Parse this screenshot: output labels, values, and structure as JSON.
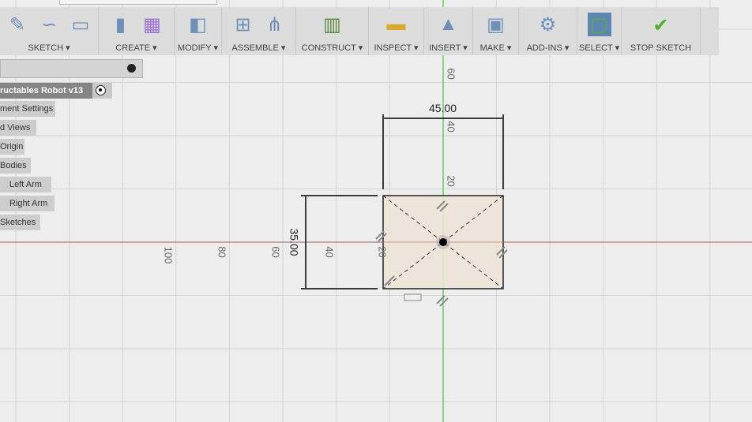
{
  "toolbar": {
    "groups": [
      {
        "label": "SKETCH ▾",
        "icons": [
          "create-sketch-icon",
          "spline-icon",
          "rectangle-icon"
        ]
      },
      {
        "label": "CREATE ▾",
        "icons": [
          "extrude-icon",
          "form-icon"
        ]
      },
      {
        "label": "MODIFY ▾",
        "icons": [
          "press-pull-icon"
        ]
      },
      {
        "label": "ASSEMBLE ▾",
        "icons": [
          "new-component-icon",
          "joint-icon"
        ]
      },
      {
        "label": "CONSTRUCT ▾",
        "icons": [
          "offset-plane-icon"
        ]
      },
      {
        "label": "INSPECT ▾",
        "icons": [
          "measure-icon"
        ]
      },
      {
        "label": "INSERT ▾",
        "icons": [
          "insert-image-icon"
        ]
      },
      {
        "label": "MAKE ▾",
        "icons": [
          "3d-print-icon"
        ]
      },
      {
        "label": "ADD-INS ▾",
        "icons": [
          "scripts-addins-icon"
        ]
      },
      {
        "label": "SELECT ▾",
        "icons": [
          "window-select-icon"
        ]
      },
      {
        "label": "STOP SKETCH",
        "icons": [
          "stop-sketch-icon"
        ]
      }
    ]
  },
  "browser": {
    "root": "ructables Robot v13",
    "items": [
      "ment Settings",
      "d Views",
      "Origin",
      "Bodies",
      "Left Arm",
      "Right Arm",
      "Sketches"
    ]
  },
  "sketch": {
    "width_dim": "45.00",
    "height_dim": "35.00"
  },
  "axis_labels": {
    "horizontal": [
      "100",
      "80",
      "60",
      "40",
      "20"
    ],
    "vertical": [
      "60",
      "40",
      "20"
    ]
  },
  "colors": {
    "x_axis": "#d96060",
    "y_axis": "#5fd35f",
    "profile_fill": "#ede3d6",
    "select_active": "#5b87b0"
  }
}
